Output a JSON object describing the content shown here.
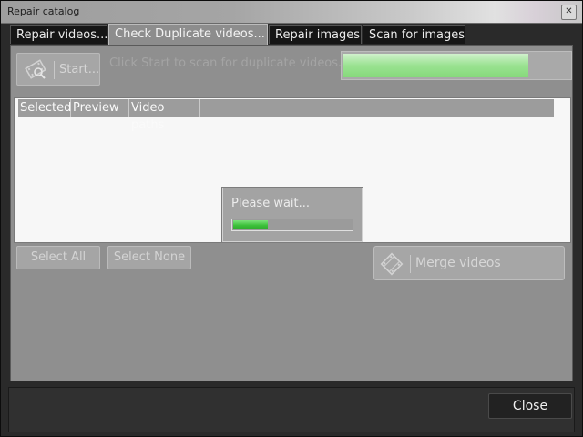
{
  "window": {
    "title": "Repair catalog"
  },
  "tabs": [
    {
      "label": "Repair videos...",
      "active": false
    },
    {
      "label": "Check Duplicate videos...",
      "active": true
    },
    {
      "label": "Repair images",
      "active": false
    },
    {
      "label": "Scan for images",
      "active": false
    }
  ],
  "scan": {
    "start_label": "Start...",
    "hint": "Click Start to scan for duplicate videos...",
    "progress": 0.82
  },
  "table": {
    "columns": [
      "Selected",
      "Preview",
      "Video paths"
    ]
  },
  "wait_dialog": {
    "label": "Please wait...",
    "progress": 0.3
  },
  "actions": {
    "select_all": "Select All",
    "select_none": "Select None",
    "merge": "Merge videos"
  },
  "footer": {
    "close_label": "Close"
  },
  "colors": {
    "progress_green": "#86d97b",
    "wait_green": "#3cc13a"
  },
  "icons": {
    "start": "film-scan-icon",
    "merge": "film-merge-icon",
    "window_close": "close-icon"
  }
}
